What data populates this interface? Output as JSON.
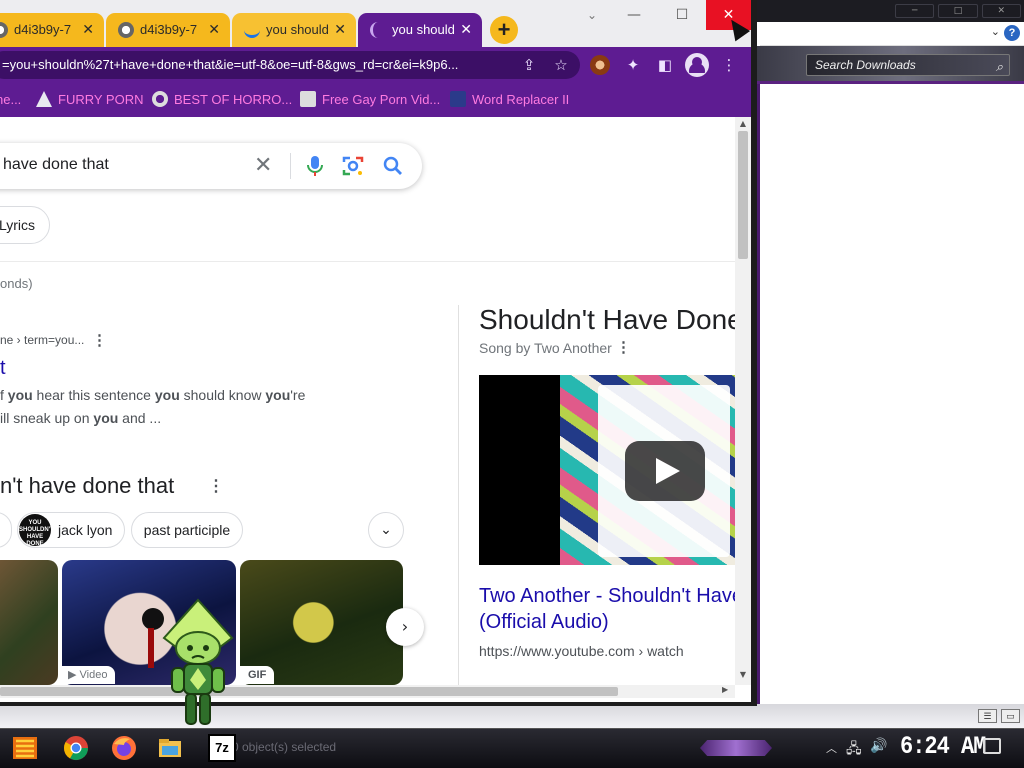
{
  "explorer": {
    "search_placeholder": "Search Downloads",
    "status_text": "0 object(s) selected"
  },
  "browser": {
    "tabs": [
      {
        "label": "d4i3b9y-7"
      },
      {
        "label": "d4i3b9y-7"
      },
      {
        "label": "you should"
      },
      {
        "label": "you should",
        "active": true
      }
    ],
    "new_tab": "+",
    "window": {
      "minimize": "—",
      "maximize": "☐",
      "close": "✕"
    },
    "url": "=you+shouldn%27t+have+done+that&ie=utf-8&oe=utf-8&gws_rd=cr&ei=k9p6...",
    "bookmarks": [
      {
        "label": "ne..."
      },
      {
        "label": "FURRY PORN"
      },
      {
        "label": "BEST OF HORRO..."
      },
      {
        "label": "Free Gay Porn Vid..."
      },
      {
        "label": "Word Replacer II"
      }
    ]
  },
  "search": {
    "query": "have done that",
    "chip_lyrics": "Lyrics",
    "result_stats": "onds)"
  },
  "result": {
    "breadcrumb": "ne › term=you...",
    "title": "t",
    "snippet_line1_pre": "f ",
    "snippet_line1_b1": "you",
    "snippet_line1_mid": " hear this sentence ",
    "snippet_line1_b2": "you",
    "snippet_line1_mid2": " should know ",
    "snippet_line1_b3": "you",
    "snippet_line1_post": "'re",
    "snippet_line2_pre": "ill sneak up on ",
    "snippet_line2_b": "you",
    "snippet_line2_post": " and ..."
  },
  "images": {
    "heading": "n't have done that",
    "chips": [
      {
        "label": "jack lyon",
        "thumb_text": "YOU SHOULDN'T HAVE DONE"
      },
      {
        "label": "past participle"
      }
    ],
    "video_badge": "▶ Video",
    "gif_badge": "GIF"
  },
  "knowledge_panel": {
    "title": "Shouldn't Have Done",
    "subtitle": "Song by Two Another",
    "link_line1": "Two Another - Shouldn't Have",
    "link_line2": "(Official Audio)",
    "url": "https://www.youtube.com › watch"
  },
  "taskbar": {
    "clock": "6:24 AM",
    "sevenzip_label": "7z"
  },
  "colors": {
    "chrome_theme": "#5e1c92",
    "tab_inactive": "#f5b81d",
    "bookmark_text": "#ff7be0",
    "link_blue": "#1a0dab",
    "close_red": "#e81123"
  }
}
